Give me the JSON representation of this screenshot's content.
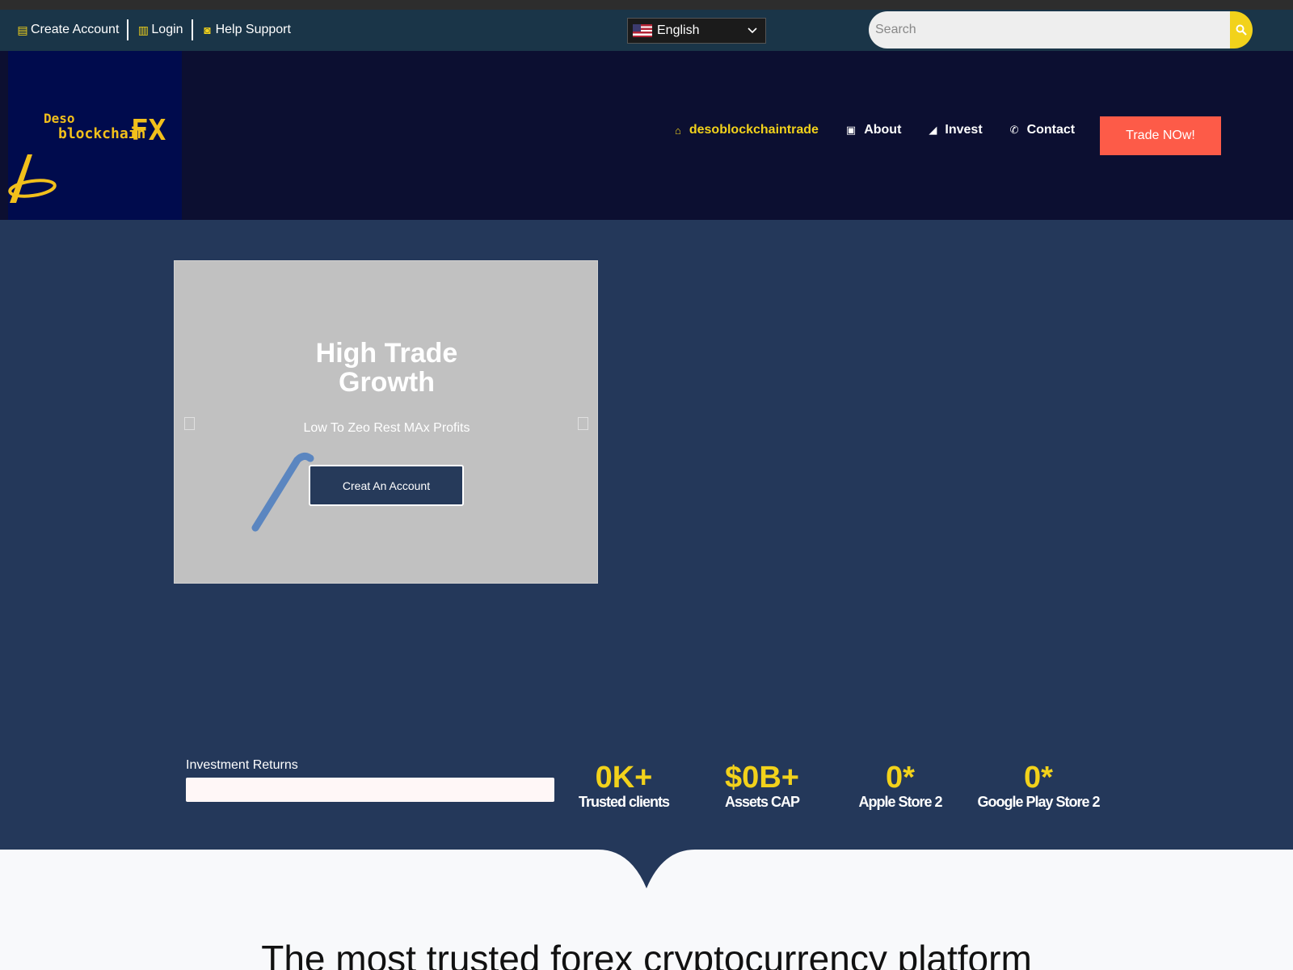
{
  "topbar": {
    "create_account": "Create Account",
    "login": "Login",
    "help_support": "Help Support",
    "language": "English",
    "search_placeholder": "Search",
    "accent_color": "#f2d21b",
    "background_color": "#1a3548"
  },
  "header": {
    "logo": {
      "line1": "Deso",
      "line2": "blockchain",
      "line3": "FX"
    },
    "nav": [
      {
        "label": "desoblockchaintrade",
        "icon": "home-icon"
      },
      {
        "label": "About",
        "icon": "id-card-icon"
      },
      {
        "label": "Invest",
        "icon": "chart-icon"
      },
      {
        "label": "Contact",
        "icon": "phone-icon"
      }
    ],
    "cta_label": "Trade NOw!",
    "cta_color": "#fd5b48"
  },
  "hero": {
    "slide_title_line1": "High Trade",
    "slide_title_line2": "Growth",
    "slide_subtitle": "Low To Zeo Rest MAx Profits",
    "slide_button": "Creat An Account"
  },
  "stats": {
    "returns_label": "Investment Returns",
    "returns_progress_percent": 0,
    "items": [
      {
        "value": "0K+",
        "label": "Trusted clients"
      },
      {
        "value": "$0B+",
        "label": "Assets CAP"
      },
      {
        "value": "0*",
        "label": "Apple Store 2"
      },
      {
        "value": "0*",
        "label": "Google Play Store 2"
      }
    ]
  },
  "section": {
    "title": "The most trusted forex cryptocurrency platform"
  }
}
